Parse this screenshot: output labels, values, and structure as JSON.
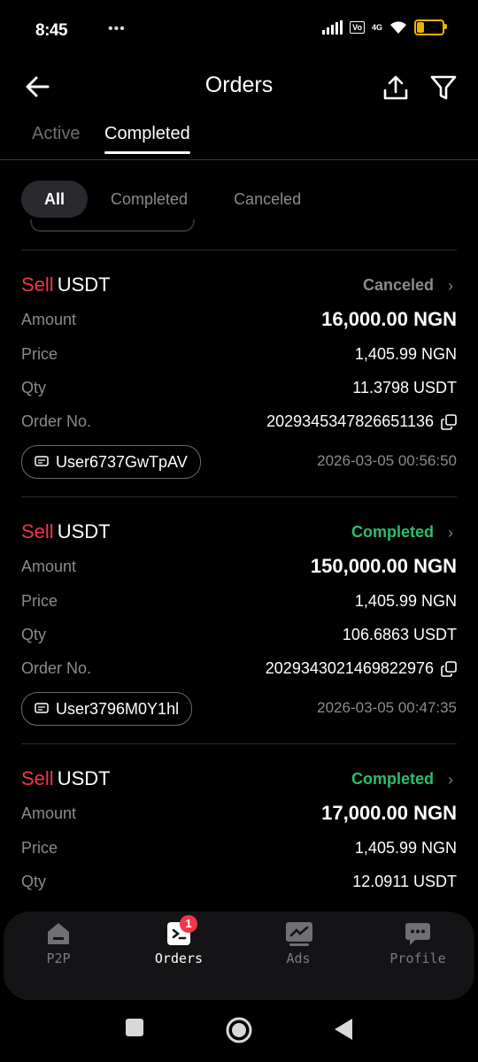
{
  "status_bar": {
    "time": "8:45",
    "notification_dots": "•••",
    "volte": "Vo",
    "network": "4G",
    "battery_level": "26",
    "battery_fraction": 0.26
  },
  "header": {
    "title": "Orders"
  },
  "tabs": [
    {
      "label": "Active",
      "active": false
    },
    {
      "label": "Completed",
      "active": true
    }
  ],
  "filters": [
    {
      "label": "All",
      "selected": true
    },
    {
      "label": "Completed",
      "selected": false
    },
    {
      "label": "Canceled",
      "selected": false
    }
  ],
  "labels": {
    "amount": "Amount",
    "price": "Price",
    "qty": "Qty",
    "order_no": "Order No."
  },
  "orders": [
    {
      "side": "Sell",
      "asset": "USDT",
      "status": "Canceled",
      "status_color": "#8a8a90",
      "amount": "16,000.00 NGN",
      "price": "1,405.99 NGN",
      "qty": "11.3798 USDT",
      "order_no": "2029345347826651136",
      "counterparty": "User6737GwTpAV",
      "time": "2026-03-05 00:56:50"
    },
    {
      "side": "Sell",
      "asset": "USDT",
      "status": "Completed",
      "status_color": "#2ebd6b",
      "amount": "150,000.00 NGN",
      "price": "1,405.99 NGN",
      "qty": "106.6863 USDT",
      "order_no": "2029343021469822976",
      "counterparty": "User3796M0Y1hl",
      "time": "2026-03-05 00:47:35"
    },
    {
      "side": "Sell",
      "asset": "USDT",
      "status": "Completed",
      "status_color": "#2ebd6b",
      "amount": "17,000.00 NGN",
      "price": "1,405.99 NGN",
      "qty": "12.0911 USDT",
      "order_no": "",
      "counterparty": "",
      "time": ""
    }
  ],
  "bottom_nav": [
    {
      "label": "P2P",
      "icon": "home-icon",
      "active": false
    },
    {
      "label": "Orders",
      "icon": "orders-icon",
      "active": true,
      "badge": "1"
    },
    {
      "label": "Ads",
      "icon": "ads-chart-icon",
      "active": false
    },
    {
      "label": "Profile",
      "icon": "chat-bubble-icon",
      "active": false
    }
  ],
  "colors": {
    "sell": "#f0374a",
    "completed": "#2ebd6b",
    "canceled": "#8a8a90",
    "background": "#000000",
    "battery": "#e6b400"
  }
}
